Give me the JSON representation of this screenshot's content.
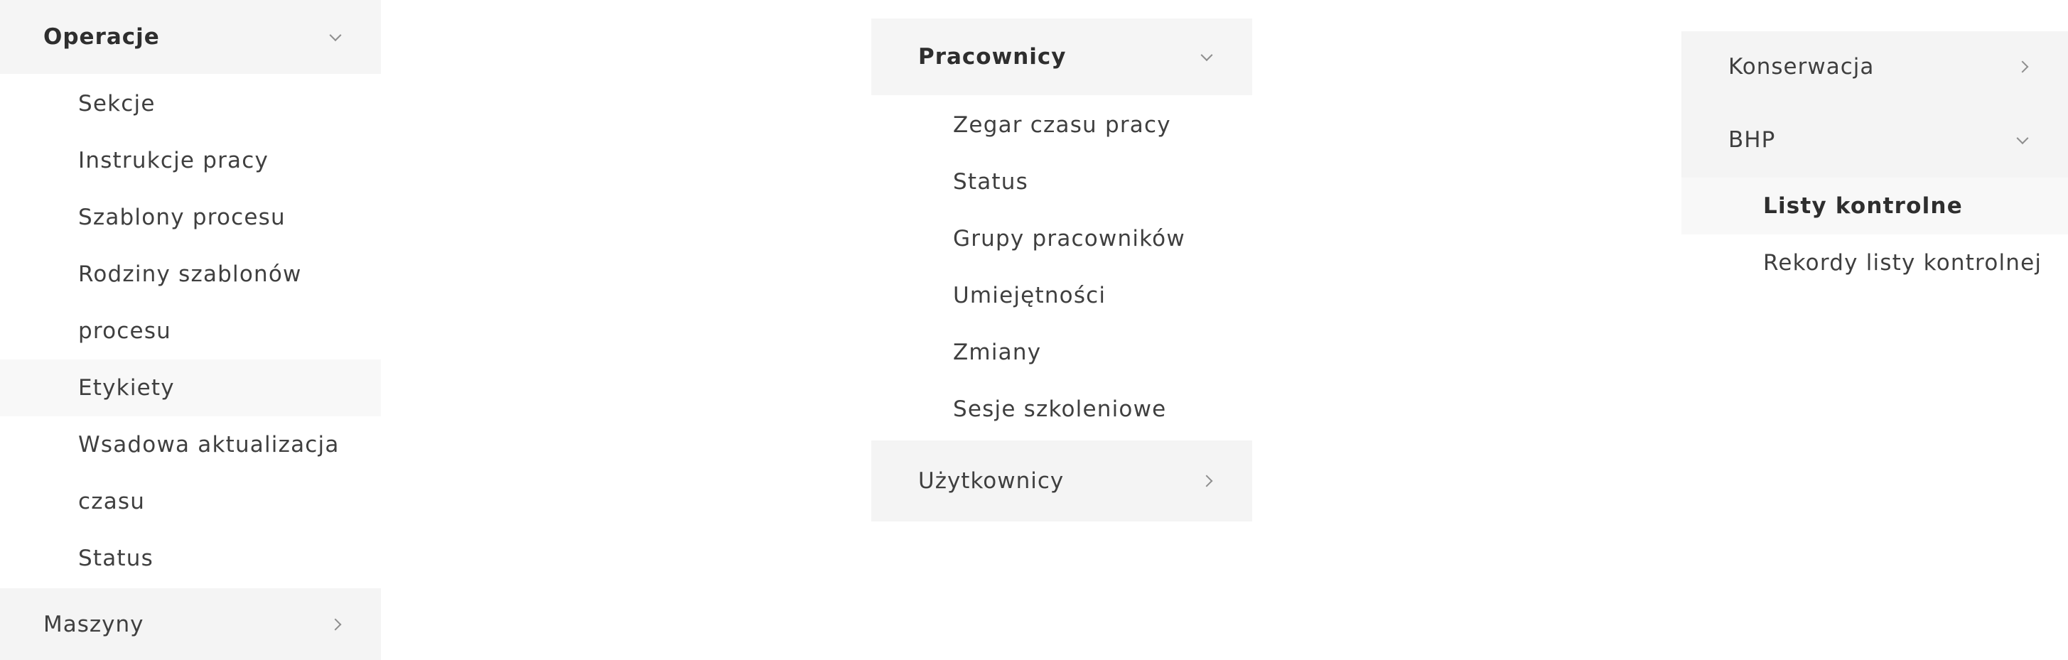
{
  "left_panel": {
    "group": {
      "label": "Operacje"
    },
    "items": [
      "Sekcje",
      "Instrukcje pracy",
      "Szablony procesu",
      "Rodziny szablonów procesu",
      "Etykiety",
      "Wsadowa aktualizacja czasu",
      "Status"
    ],
    "collapsed_group": {
      "label": "Maszyny"
    }
  },
  "middle_panel": {
    "group": {
      "label": "Pracownicy"
    },
    "items": [
      "Zegar czasu pracy",
      "Status",
      "Grupy pracowników",
      "Umiejętności",
      "Zmiany",
      "Sesje szkoleniowe"
    ],
    "collapsed_group": {
      "label": "Użytkownicy"
    }
  },
  "right_panel": {
    "collapsed_group": {
      "label": "Konserwacja"
    },
    "group": {
      "label": "BHP"
    },
    "items": [
      "Listy kontrolne",
      "Rekordy listy kontrolnej"
    ]
  },
  "icons": {
    "expanded": "chevron-down-icon",
    "collapsed": "chevron-right-icon"
  },
  "colors": {
    "header_background": "#f5f5f5",
    "selected_background": "#f8f8f8",
    "text": "#3f3f3f",
    "chevron": "#8e8e8e"
  }
}
